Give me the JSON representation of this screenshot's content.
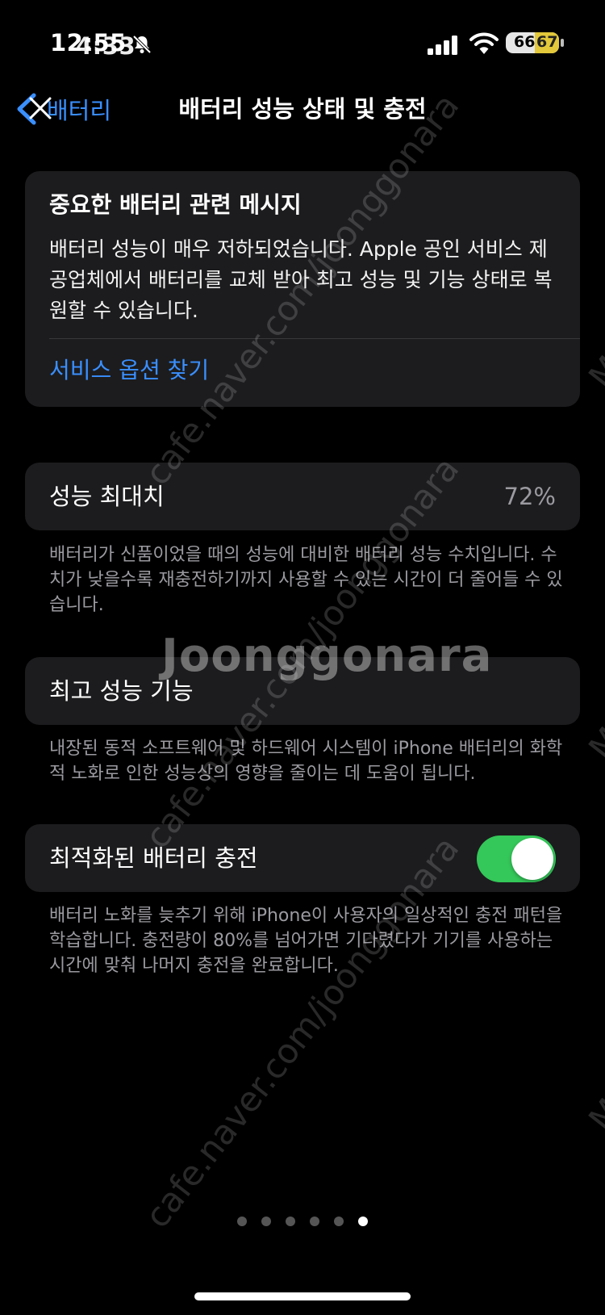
{
  "status_bar": {
    "time": "12:55",
    "time_overlay": "4:33",
    "battery_level": "66",
    "battery_level_overlay": "67",
    "icons": [
      "bell-slash-icon",
      "cellular-signal-icon",
      "wifi-icon",
      "battery-icon"
    ]
  },
  "nav": {
    "back_label": "배터리",
    "title": "배터리 성능 상태 및 충전"
  },
  "message_card": {
    "title": "중요한 배터리 관련 메시지",
    "body": "배터리 성능이 매우 저하되었습니다. Apple 공인 서비스 제공업체에서 배터리를 교체 받아 최고 성능 및 기능 상태로 복원할 수 있습니다.",
    "link": "서비스 옵션 찾기"
  },
  "max_capacity": {
    "label": "성능 최대치",
    "value": "72%",
    "footnote": "배터리가 신품이었을 때의 성능에 대비한 배터리 성능 수치입니다. 수치가 낮을수록 재충전하기까지 사용할 수 있는 시간이 더 줄어들 수 있습니다."
  },
  "peak_performance": {
    "label": "최고 성능 기능",
    "footnote": "내장된 동적 소프트웨어 및 하드웨어 시스템이 iPhone 배터리의 화학적 노화로 인한 성능상의 영향을 줄이는 데 도움이 됩니다."
  },
  "optimized_charging": {
    "label": "최적화된 배터리 충전",
    "enabled": true,
    "footnote": "배터리 노화를 늦추기 위해 iPhone이 사용자의 일상적인 충전 패턴을 학습합니다. 충전량이 80%를 넘어가면 기다렸다가 기기를 사용하는 시간에 맞춰 나머지 충전을 완료합니다."
  },
  "page_indicator": {
    "count": 6,
    "active_index": 5
  },
  "watermark": {
    "url": "cafe.naver.com/joonggonara",
    "logo": "Joonggonara",
    "side": "M"
  },
  "colors": {
    "background": "#000000",
    "card": "#1c1c1e",
    "link_blue": "#3a8fff",
    "toggle_green": "#34c759",
    "secondary_text": "#9a9aa0"
  }
}
